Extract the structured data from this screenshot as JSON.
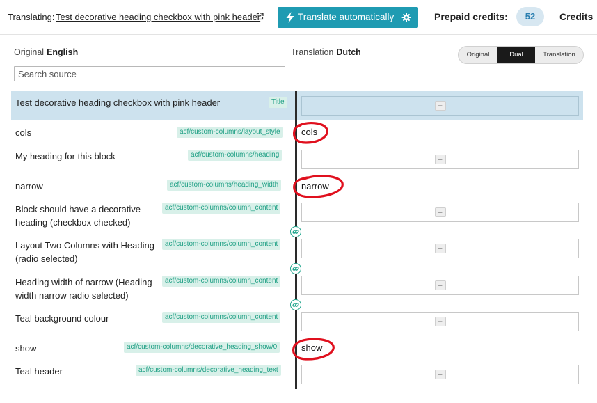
{
  "topbar": {
    "translating_label": "Translating:",
    "translating_title": "Test decorative heading checkbox with pink header",
    "translate_button_label": "Translate automatically",
    "credits_label": "Prepaid credits:",
    "credits_value": "52",
    "credits_link": "Credits"
  },
  "header": {
    "original_label": "Original",
    "original_lang": "English",
    "translation_label": "Translation",
    "translation_lang": "Dutch",
    "search_placeholder": "Search source",
    "view_options": [
      "Original",
      "Dual",
      "Translation"
    ],
    "view_selected": "Dual"
  },
  "rows": [
    {
      "source": "Test decorative heading checkbox with pink header",
      "tag": "Title",
      "translation": ""
    },
    {
      "source": "cols",
      "tag": "acf/custom-columns/layout_style",
      "translation": "cols"
    },
    {
      "source": "My heading for this block",
      "tag": "acf/custom-columns/heading",
      "translation": ""
    },
    {
      "source": "narrow",
      "tag": "acf/custom-columns/heading_width",
      "translation": "narrow"
    },
    {
      "source": "Block should have a decorative heading (checkbox checked)",
      "tag": "acf/custom-columns/column_content",
      "translation": ""
    },
    {
      "source": "Layout Two Columns with Heading (radio selected)",
      "tag": "acf/custom-columns/column_content",
      "translation": ""
    },
    {
      "source": "Heading width of narrow (Heading width narrow radio selected)",
      "tag": "acf/custom-columns/column_content",
      "translation": ""
    },
    {
      "source": "Teal background colour",
      "tag": "acf/custom-columns/column_content",
      "translation": ""
    },
    {
      "source": "show",
      "tag": "acf/custom-columns/decorative_heading_show/0",
      "translation": "show"
    },
    {
      "source": "Teal header",
      "tag": "acf/custom-columns/decorative_heading_text",
      "translation": ""
    }
  ],
  "add_button_label": "+",
  "colors": {
    "accent": "#1f9bb2",
    "tag_text": "#20a085",
    "tag_bg": "#d8f0e9",
    "selected_row": "#cde2ee",
    "annotation": "#e0101e"
  }
}
